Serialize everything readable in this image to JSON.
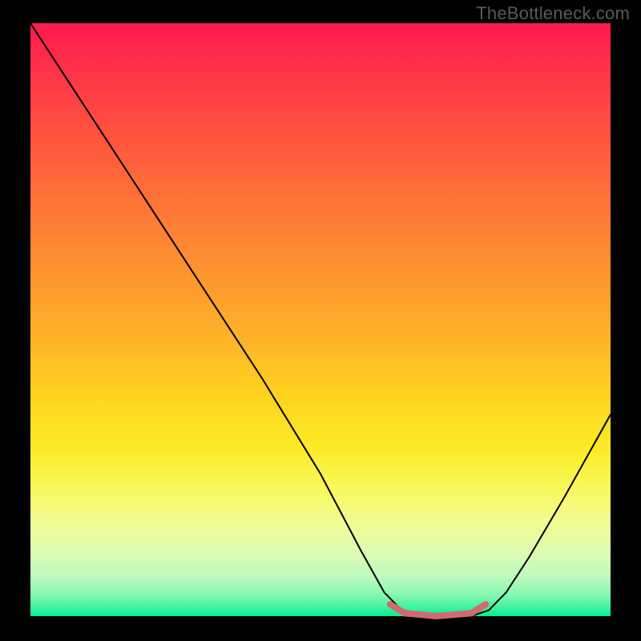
{
  "watermark": "TheBottleneck.com",
  "chart_data": {
    "type": "line",
    "title": "",
    "xlabel": "",
    "ylabel": "",
    "xlim": [
      0,
      1
    ],
    "ylim": [
      0,
      1
    ],
    "grid": false,
    "legend": false,
    "series": [
      {
        "name": "curve",
        "x": [
          0.0,
          0.04,
          0.1,
          0.2,
          0.3,
          0.4,
          0.5,
          0.57,
          0.61,
          0.64,
          0.7,
          0.76,
          0.79,
          0.82,
          0.86,
          0.92,
          1.0
        ],
        "values": [
          1.0,
          0.94,
          0.85,
          0.7,
          0.55,
          0.4,
          0.24,
          0.11,
          0.04,
          0.01,
          0.0,
          0.0,
          0.01,
          0.04,
          0.1,
          0.2,
          0.34
        ],
        "color": "#000000",
        "width": 2
      },
      {
        "name": "flat-segment-marker",
        "x": [
          0.62,
          0.645,
          0.7,
          0.76,
          0.785
        ],
        "values": [
          0.02,
          0.005,
          0.0,
          0.005,
          0.02
        ],
        "color": "#cf6a6f",
        "width": 8
      }
    ],
    "background_gradient": {
      "type": "vertical",
      "stops": [
        {
          "pos": 0.0,
          "color": "#ff1a4d"
        },
        {
          "pos": 0.5,
          "color": "#ffb528"
        },
        {
          "pos": 0.78,
          "color": "#f8f85a"
        },
        {
          "pos": 1.0,
          "color": "#00ee8f"
        }
      ]
    }
  }
}
